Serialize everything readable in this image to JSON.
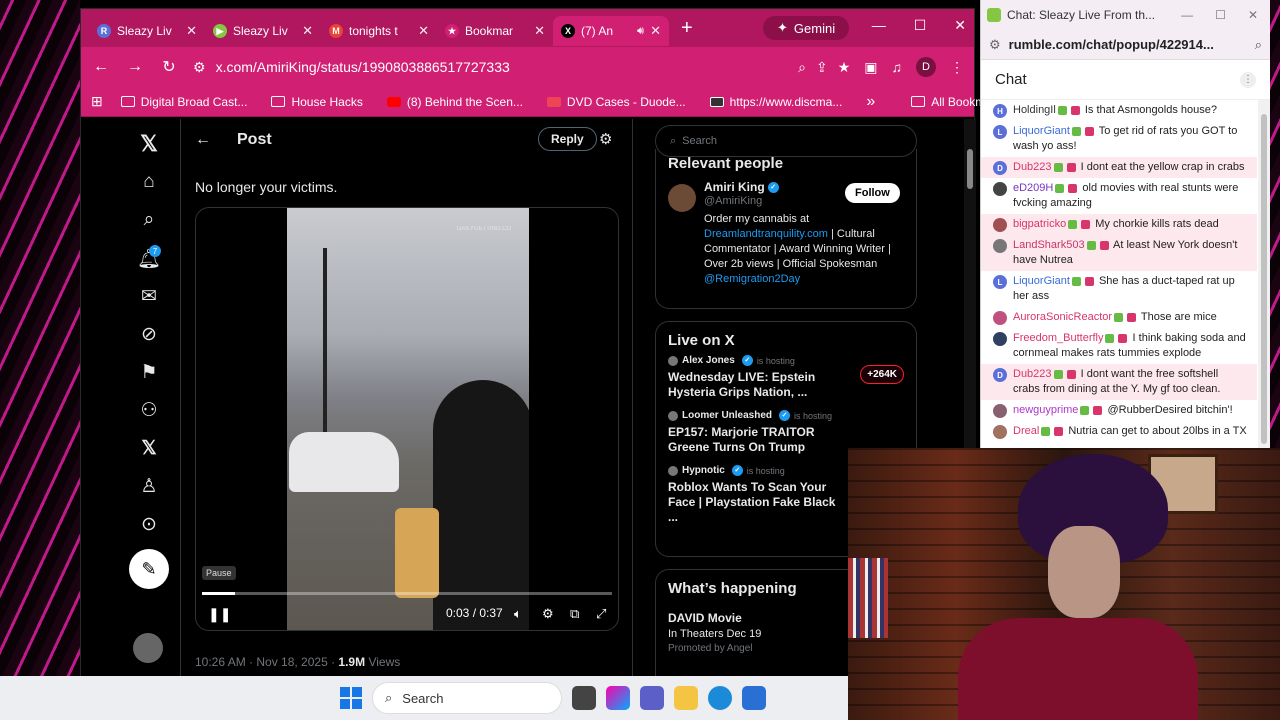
{
  "browser": {
    "tabs": [
      {
        "label": "Sleazy Liv",
        "icon_letter": "R",
        "icon_color": "#5b6fd8",
        "active": false
      },
      {
        "label": "Sleazy Liv",
        "icon_letter": "▶",
        "icon_color": "#85c742",
        "active": false
      },
      {
        "label": "tonights t",
        "icon_letter": "M",
        "icon_color": "#ea4335",
        "active": false
      },
      {
        "label": "Bookmar",
        "icon_letter": "★",
        "icon_color": "#d11f73",
        "active": false
      },
      {
        "label": "(7) An",
        "icon_letter": "X",
        "icon_color": "#000000",
        "active": true
      }
    ],
    "new_tab": "+",
    "gemini_label": "Gemini",
    "url": "x.com/AmiriKing/status/1990803886517727333",
    "profile_initial": "D",
    "bookmarks": [
      {
        "label": "Digital Broad Cast...",
        "icon": "folder-icon"
      },
      {
        "label": "House Hacks",
        "icon": "folder-icon"
      },
      {
        "label": "(8) Behind the Scen...",
        "icon": "youtube-icon"
      },
      {
        "label": "DVD Cases - Duode...",
        "icon": "dvd-icon"
      },
      {
        "label": "https://www.discma...",
        "icon": "site-icon"
      }
    ],
    "bookmarks_more": "»",
    "all_bookmarks": "All Bookmarks"
  },
  "x": {
    "post_title": "Post",
    "reply_label": "Reply",
    "notification_count": "7",
    "post_text": "No longer your victims.",
    "video": {
      "watermark": "DAILYGETTING.CO",
      "tooltip": "Pause",
      "time": "0:03 / 0:37",
      "progress_fraction": 0.081
    },
    "meta_time": "10:26 AM · Nov 18, 2025 · ",
    "meta_views": "1.9M",
    "meta_views_label": " Views",
    "search_placeholder": "Search",
    "relevant": {
      "title": "Relevant people",
      "name": "Amiri King",
      "handle": "@AmiriKing",
      "follow": "Follow",
      "bio_1": "Order my cannabis at ",
      "bio_link": "Dreamlandtranquility.com",
      "bio_2": " | Cultural Commentator | Award Winning Writer | Over 2b views | Official Spokesman ",
      "bio_link2": "@Remigration2Day"
    },
    "live": {
      "title": "Live on X",
      "hosting": "is hosting",
      "items": [
        {
          "host": "Alex Jones",
          "verified": true,
          "title": "Wednesday LIVE: Epstein Hysteria Grips Nation, ...",
          "count": "+264K"
        },
        {
          "host": "Loomer Unleashed",
          "verified": true,
          "title": "EP157: Marjorie TRAITOR Greene Turns On Trump",
          "count": ""
        },
        {
          "host": "Hypnotic",
          "verified": true,
          "title": "Roblox Wants To Scan Your Face | Playstation Fake Black ...",
          "count": ""
        }
      ]
    },
    "happening": {
      "title": "What’s happening",
      "item_title": "DAVID Movie",
      "item_sub": "In Theaters Dec 19",
      "promoted": "Promoted by Angel"
    }
  },
  "chat": {
    "window_title": "Chat: Sleazy Live From th...",
    "url": "rumble.com/chat/popup/422914...",
    "header": "Chat",
    "messages": [
      {
        "initial": "H",
        "color": "#5b6fd8",
        "name": "HoldingIl",
        "name_color": "#333333",
        "text": "Is that Asmongolds house?",
        "highlight": false
      },
      {
        "initial": "L",
        "color": "#5b6fd8",
        "name": "LiquorGiant",
        "name_color": "#3b6bd8",
        "text": "To get rid of rats you GOT to wash yo ass!",
        "highlight": false
      },
      {
        "initial": "D",
        "color": "#5b6fd8",
        "name": "Dub223",
        "name_color": "#d8356a",
        "text": "I dont eat the yellow crap in crabs",
        "highlight": true
      },
      {
        "initial": "",
        "color": "#444444",
        "name": "eD209H",
        "name_color": "#7a35c8",
        "text": "old movies with real stunts were fvcking amazing",
        "highlight": false
      },
      {
        "initial": "",
        "color": "#a05050",
        "name": "bigpatricko",
        "name_color": "#d8356a",
        "text": "My chorkie kills rats dead",
        "highlight": true
      },
      {
        "initial": "",
        "color": "#777777",
        "name": "LandShark503",
        "name_color": "#c8356a",
        "text": "At least New York doesn't have Nutrea",
        "highlight": true
      },
      {
        "initial": "L",
        "color": "#5b6fd8",
        "name": "LiquorGiant",
        "name_color": "#3b6bd8",
        "text": "She has a duct-taped rat up her ass",
        "highlight": false
      },
      {
        "initial": "",
        "color": "#c05080",
        "name": "AuroraSonicReactor",
        "name_color": "#d8356a",
        "text": "Those are mice",
        "highlight": false
      },
      {
        "initial": "",
        "color": "#304060",
        "name": "Freedom_Butterfly",
        "name_color": "#d8356a",
        "text": "I think baking soda and cornmeal makes rats tummies explode",
        "highlight": false
      },
      {
        "initial": "D",
        "color": "#5b6fd8",
        "name": "Dub223",
        "name_color": "#d8356a",
        "text": "I dont want the free softshell crabs from dining at the Y. My gf too clean.",
        "highlight": true
      },
      {
        "initial": "",
        "color": "#886070",
        "name": "newguyprime",
        "name_color": "#b035c8",
        "text": "@RubberDesired bitchin'!",
        "highlight": false
      },
      {
        "initial": "",
        "color": "#a07060",
        "name": "Dreal",
        "name_color": "#d8356a",
        "text": "Nutria can get to about 20lbs in a TX",
        "highlight": false
      }
    ]
  },
  "taskbar": {
    "search_placeholder": "Search"
  }
}
